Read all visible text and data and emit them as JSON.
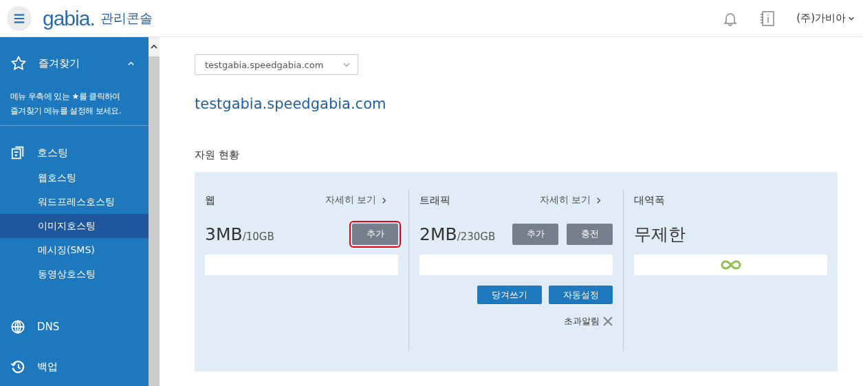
{
  "header": {
    "logo": "gabia.",
    "title": "관리콘솔",
    "account": "(주)가비아"
  },
  "sidebar": {
    "favorites": {
      "label": "즐겨찾기",
      "expanded": true,
      "hint": "메뉴 우측에 있는 ★를 클릭하여 즐겨찾기 메뉴를 설정해 보세요."
    },
    "groups": [
      {
        "label": "호스팅",
        "kind": "hosting",
        "children": [
          {
            "label": "웹호스팅",
            "selected": false
          },
          {
            "label": "워드프레스호스팅",
            "selected": false
          },
          {
            "label": "이미지호스팅",
            "selected": true
          },
          {
            "label": "메시징(SMS)",
            "selected": false
          },
          {
            "label": "동영상호스팅",
            "selected": false
          }
        ]
      },
      {
        "label": "DNS",
        "kind": "dns"
      },
      {
        "label": "백업",
        "kind": "backup"
      }
    ]
  },
  "domain_select": {
    "value": "testgabia.speedgabia.com"
  },
  "domain_title": "testgabia.speedgabia.com",
  "section_title": "자원 현황",
  "resources": [
    {
      "kind": "usage",
      "title": "웹",
      "detail_link": "자세히 보기",
      "used": "3MB",
      "total": "/10GB",
      "buttons": [
        {
          "label": "추가",
          "highlighted": true
        }
      ]
    },
    {
      "kind": "usage",
      "title": "트래픽",
      "detail_link": "자세히 보기",
      "used": "2MB",
      "total": "/230GB",
      "buttons": [
        {
          "label": "추가",
          "highlighted": false
        },
        {
          "label": "충전",
          "highlighted": false
        }
      ],
      "actions": [
        "당겨쓰기",
        "자동설정"
      ],
      "alert": "초과알림"
    },
    {
      "kind": "unlimited",
      "title": "대역폭",
      "value": "무제한"
    }
  ]
}
